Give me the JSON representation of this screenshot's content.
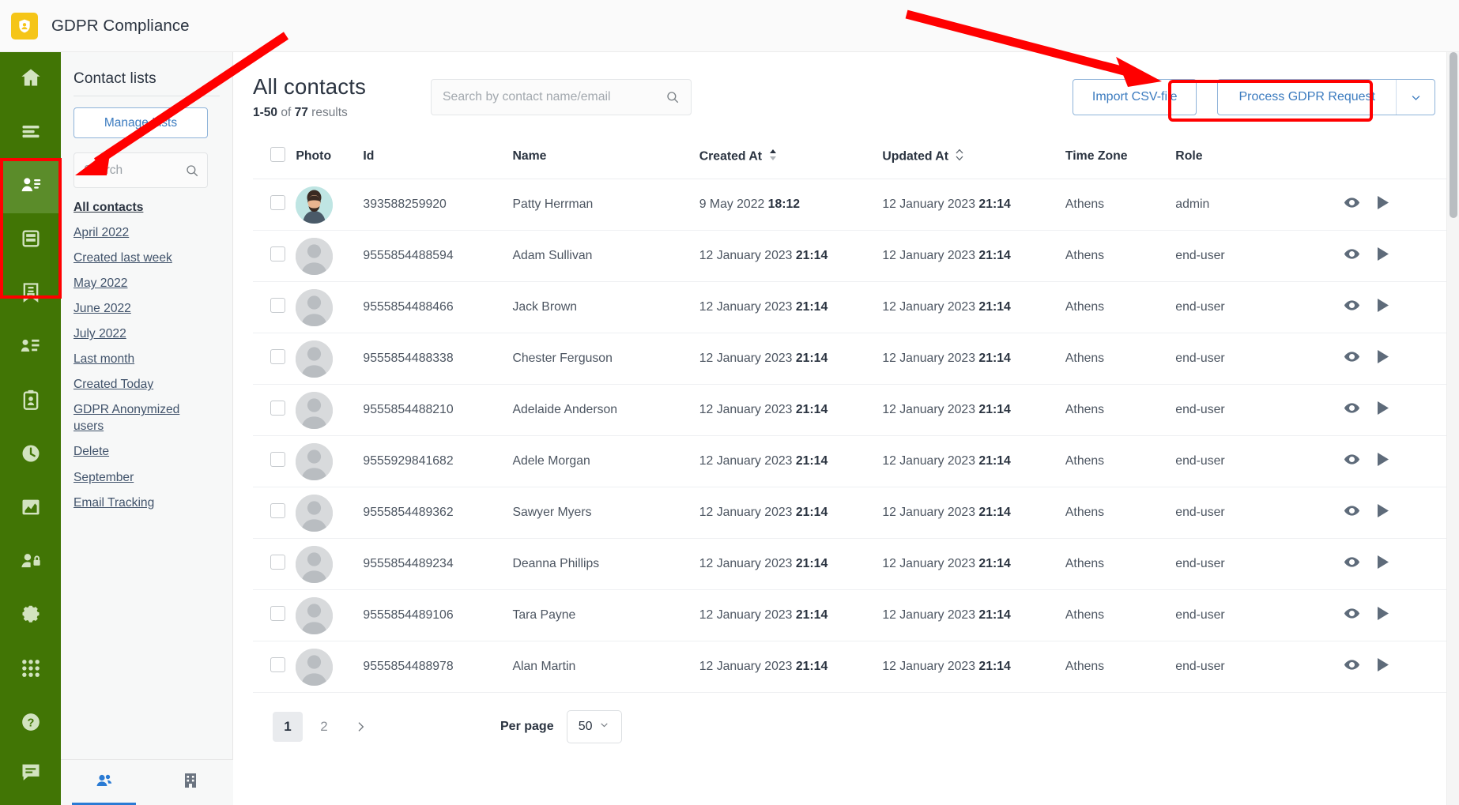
{
  "app": {
    "title": "GDPR Compliance",
    "logo_icon": "shield-user-icon",
    "accent_green": "#417505",
    "accent_blue": "#3b7bbf",
    "annotation_red": "#ff0000"
  },
  "rail": {
    "items": [
      {
        "name": "home",
        "icon": "home-icon",
        "active": false
      },
      {
        "name": "lists",
        "icon": "list-lines-icon",
        "active": false
      },
      {
        "name": "contacts",
        "icon": "contact-card-icon",
        "active": true
      },
      {
        "name": "database",
        "icon": "database-icon",
        "active": false
      },
      {
        "name": "bookmark",
        "icon": "bookmark-doc-icon",
        "active": false
      },
      {
        "name": "org-chart",
        "icon": "org-chart-icon",
        "active": false
      },
      {
        "name": "clipboard-user",
        "icon": "clipboard-user-icon",
        "active": false
      },
      {
        "name": "history",
        "icon": "clock-icon",
        "active": false
      },
      {
        "name": "analytics",
        "icon": "chart-area-icon",
        "active": false
      },
      {
        "name": "privacy",
        "icon": "user-lock-icon",
        "active": false
      },
      {
        "name": "settings",
        "icon": "gear-icon",
        "active": false
      },
      {
        "name": "apps",
        "icon": "grid-dots-icon",
        "active": false
      },
      {
        "name": "help",
        "icon": "question-circle-icon",
        "active": false
      },
      {
        "name": "chat",
        "icon": "chat-bubble-icon",
        "active": false
      }
    ]
  },
  "lists_panel": {
    "heading": "Contact lists",
    "manage_button": "Manage Lists",
    "search_placeholder": "Search",
    "search_value": "",
    "search_icon": "search-icon",
    "links": [
      {
        "label": "All contacts",
        "selected": true
      },
      {
        "label": "April 2022",
        "selected": false
      },
      {
        "label": "Created last week",
        "selected": false
      },
      {
        "label": "May 2022",
        "selected": false
      },
      {
        "label": "June 2022",
        "selected": false
      },
      {
        "label": "July 2022",
        "selected": false
      },
      {
        "label": "Last month",
        "selected": false
      },
      {
        "label": "Created Today",
        "selected": false
      },
      {
        "label": "GDPR Anonymized users",
        "selected": false
      },
      {
        "label": "Delete",
        "selected": false
      },
      {
        "label": "September",
        "selected": false
      },
      {
        "label": "Email Tracking",
        "selected": false
      }
    ],
    "bottom_tabs": [
      {
        "name": "contacts-tab",
        "icon": "people-icon",
        "active": true
      },
      {
        "name": "companies-tab",
        "icon": "building-icon",
        "active": false
      }
    ]
  },
  "main": {
    "title": "All contacts",
    "results_range": "1-50",
    "results_of": "of",
    "results_total": "77",
    "results_word": "results",
    "search_placeholder": "Search by contact name/email",
    "search_value": "",
    "search_icon": "search-icon",
    "import_button": "Import CSV-file",
    "process_button": "Process GDPR Request",
    "process_caret_icon": "chevron-down-icon"
  },
  "table": {
    "select_all_checkbox": false,
    "columns": [
      {
        "key": "checkbox",
        "label": ""
      },
      {
        "key": "photo",
        "label": "Photo",
        "sort": null
      },
      {
        "key": "id",
        "label": "Id",
        "sort": null
      },
      {
        "key": "name",
        "label": "Name",
        "sort": null
      },
      {
        "key": "created_at",
        "label": "Created At",
        "sort": "desc"
      },
      {
        "key": "updated_at",
        "label": "Updated At",
        "sort": "none"
      },
      {
        "key": "time_zone",
        "label": "Time Zone",
        "sort": null
      },
      {
        "key": "role",
        "label": "Role",
        "sort": null
      },
      {
        "key": "actions",
        "label": ""
      }
    ],
    "row_action_icons": [
      "eye-icon",
      "play-triangle-icon"
    ],
    "rows": [
      {
        "id": "393588259920",
        "name": "Patty Herrman",
        "created_date": "9 May 2022",
        "created_time": "18:12",
        "updated_date": "12 January 2023",
        "updated_time": "21:14",
        "time_zone": "Athens",
        "role": "admin",
        "has_photo": true
      },
      {
        "id": "9555854488594",
        "name": "Adam Sullivan",
        "created_date": "12 January 2023",
        "created_time": "21:14",
        "updated_date": "12 January 2023",
        "updated_time": "21:14",
        "time_zone": "Athens",
        "role": "end-user",
        "has_photo": false
      },
      {
        "id": "9555854488466",
        "name": "Jack Brown",
        "created_date": "12 January 2023",
        "created_time": "21:14",
        "updated_date": "12 January 2023",
        "updated_time": "21:14",
        "time_zone": "Athens",
        "role": "end-user",
        "has_photo": false
      },
      {
        "id": "9555854488338",
        "name": "Chester Ferguson",
        "created_date": "12 January 2023",
        "created_time": "21:14",
        "updated_date": "12 January 2023",
        "updated_time": "21:14",
        "time_zone": "Athens",
        "role": "end-user",
        "has_photo": false
      },
      {
        "id": "9555854488210",
        "name": "Adelaide Anderson",
        "created_date": "12 January 2023",
        "created_time": "21:14",
        "updated_date": "12 January 2023",
        "updated_time": "21:14",
        "time_zone": "Athens",
        "role": "end-user",
        "has_photo": false
      },
      {
        "id": "9555929841682",
        "name": "Adele Morgan",
        "created_date": "12 January 2023",
        "created_time": "21:14",
        "updated_date": "12 January 2023",
        "updated_time": "21:14",
        "time_zone": "Athens",
        "role": "end-user",
        "has_photo": false
      },
      {
        "id": "9555854489362",
        "name": "Sawyer Myers",
        "created_date": "12 January 2023",
        "created_time": "21:14",
        "updated_date": "12 January 2023",
        "updated_time": "21:14",
        "time_zone": "Athens",
        "role": "end-user",
        "has_photo": false
      },
      {
        "id": "9555854489234",
        "name": "Deanna Phillips",
        "created_date": "12 January 2023",
        "created_time": "21:14",
        "updated_date": "12 January 2023",
        "updated_time": "21:14",
        "time_zone": "Athens",
        "role": "end-user",
        "has_photo": false
      },
      {
        "id": "9555854489106",
        "name": "Tara Payne",
        "created_date": "12 January 2023",
        "created_time": "21:14",
        "updated_date": "12 January 2023",
        "updated_time": "21:14",
        "time_zone": "Athens",
        "role": "end-user",
        "has_photo": false
      },
      {
        "id": "9555854488978",
        "name": "Alan Martin",
        "created_date": "12 January 2023",
        "created_time": "21:14",
        "updated_date": "12 January 2023",
        "updated_time": "21:14",
        "time_zone": "Athens",
        "role": "end-user",
        "has_photo": false
      }
    ]
  },
  "pagination": {
    "pages": [
      {
        "label": "1",
        "current": true
      },
      {
        "label": "2",
        "current": false
      }
    ],
    "next_icon": "chevron-right-icon",
    "per_page_label": "Per page",
    "per_page_value": "50",
    "per_page_caret_icon": "chevron-down-icon"
  },
  "annotations": {
    "arrows": [
      {
        "name": "arrow-to-contacts-rail"
      },
      {
        "name": "arrow-to-process-gdpr-button"
      }
    ],
    "boxes": [
      {
        "name": "highlight-rail-contacts-group"
      },
      {
        "name": "highlight-process-gdpr-button"
      }
    ]
  }
}
